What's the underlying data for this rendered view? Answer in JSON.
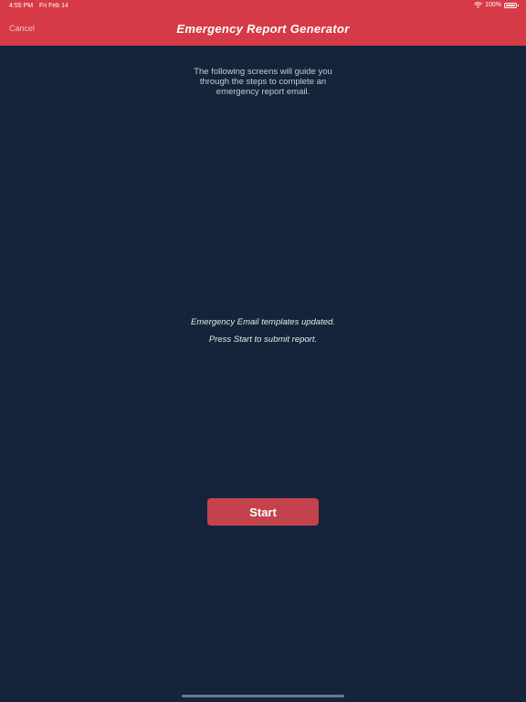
{
  "status_bar": {
    "time": "4:55 PM",
    "date": "Fri Feb 14",
    "battery_text": "100%",
    "battery_level": 1.0,
    "wifi_icon": "wifi-icon",
    "battery_icon": "battery-icon"
  },
  "nav": {
    "cancel_label": "Cancel",
    "title": "Emergency Report Generator"
  },
  "main": {
    "intro_line1": "The following screens will guide you",
    "intro_line2": "through the steps to complete an",
    "intro_line3": "emergency report email.",
    "message1": "Emergency Email templates updated.",
    "message2": "Press Start to submit report.",
    "start_label": "Start"
  },
  "colors": {
    "background": "#14253b",
    "header": "#d63a46",
    "button": "#c3424c",
    "text": "#ffffff"
  }
}
